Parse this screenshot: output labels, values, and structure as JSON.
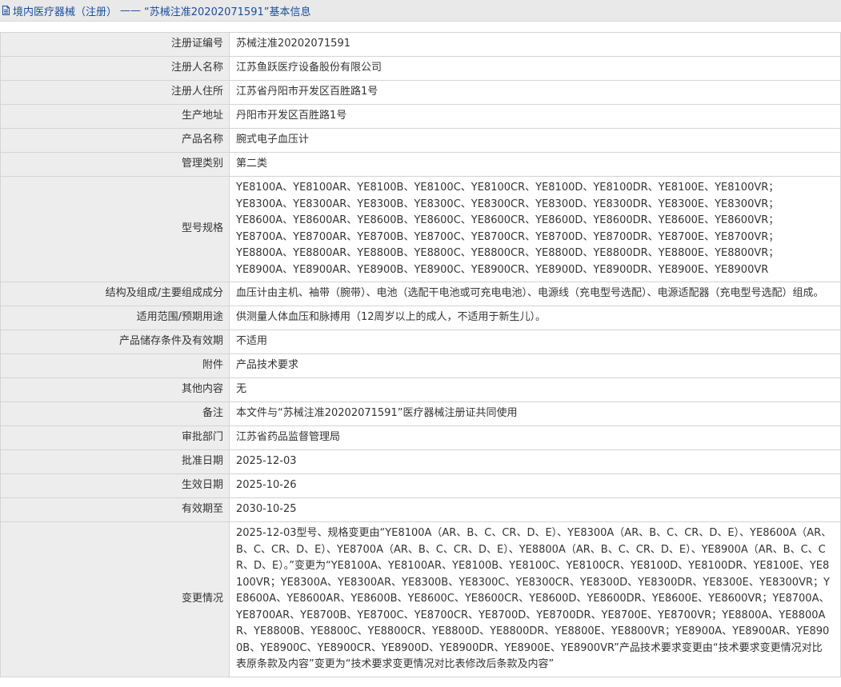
{
  "header": {
    "breadcrumb_label": "境内医疗器械（注册）",
    "separator": "——",
    "page_title": "“苏械注准20202071591”基本信息",
    "icon": "document-icon"
  },
  "rows": {
    "reg_no": {
      "label": "注册证编号",
      "value": "苏械注准20202071591"
    },
    "registrant": {
      "label": "注册人名称",
      "value": "江苏鱼跃医疗设备股份有限公司"
    },
    "registrant_address": {
      "label": "注册人住所",
      "value": "江苏省丹阳市开发区百胜路1号"
    },
    "production_address": {
      "label": "生产地址",
      "value": "丹阳市开发区百胜路1号"
    },
    "product_name": {
      "label": "产品名称",
      "value": "腕式电子血压计"
    },
    "category": {
      "label": "管理类别",
      "value": "第二类"
    },
    "models": {
      "label": "型号规格",
      "lines": [
        "YE8100A、YE8100AR、YE8100B、YE8100C、YE8100CR、YE8100D、YE8100DR、YE8100E、YE8100VR；",
        "YE8300A、YE8300AR、YE8300B、YE8300C、YE8300CR、YE8300D、YE8300DR、YE8300E、YE8300VR；",
        "YE8600A、YE8600AR、YE8600B、YE8600C、YE8600CR、YE8600D、YE8600DR、YE8600E、YE8600VR；",
        "YE8700A、YE8700AR、YE8700B、YE8700C、YE8700CR、YE8700D、YE8700DR、YE8700E、YE8700VR；",
        "YE8800A、YE8800AR、YE8800B、YE8800C、YE8800CR、YE8800D、YE8800DR、YE8800E、YE8800VR；",
        "YE8900A、YE8900AR、YE8900B、YE8900C、YE8900CR、YE8900D、YE8900DR、YE8900E、YE8900VR"
      ]
    },
    "structure": {
      "label": "结构及组成/主要组成成分",
      "value": "血压计由主机、袖带（腕带）、电池（选配干电池或可充电电池）、电源线（充电型号选配）、电源适配器（充电型号选配）组成。"
    },
    "scope": {
      "label": "适用范围/预期用途",
      "value": "供测量人体血压和脉搏用（12周岁以上的成人，不适用于新生儿）。"
    },
    "storage": {
      "label": "产品储存条件及有效期",
      "value": "不适用"
    },
    "attachment": {
      "label": "附件",
      "value": "产品技术要求"
    },
    "other": {
      "label": "其他内容",
      "value": "无"
    },
    "remark": {
      "label": "备注",
      "value": "本文件与“苏械注准20202071591”医疗器械注册证共同使用"
    },
    "approval_dept": {
      "label": "审批部门",
      "value": "江苏省药品监督管理局"
    },
    "approval_date": {
      "label": "批准日期",
      "value": "2025-12-03"
    },
    "effective_date": {
      "label": "生效日期",
      "value": "2025-10-26"
    },
    "expiry_date": {
      "label": "有效期至",
      "value": "2030-10-25"
    },
    "changes": {
      "label": "变更情况",
      "value": "2025-12-03型号、规格变更由“YE8100A（AR、B、C、CR、D、E）、YE8300A（AR、B、C、CR、D、E）、YE8600A（AR、B、C、CR、D、E）、YE8700A（AR、B、C、CR、D、E）、YE8800A（AR、B、C、CR、D、E）、YE8900A（AR、B、C、CR、D、E）。”变更为“YE8100A、YE8100AR、YE8100B、YE8100C、YE8100CR、YE8100D、YE8100DR、YE8100E、YE8100VR；YE8300A、YE8300AR、YE8300B、YE8300C、YE8300CR、YE8300D、YE8300DR、YE8300E、YE8300VR；YE8600A、YE8600AR、YE8600B、YE8600C、YE8600CR、YE8600D、YE8600DR、YE8600E、YE8600VR；YE8700A、YE8700AR、YE8700B、YE8700C、YE8700CR、YE8700D、YE8700DR、YE8700E、YE8700VR；YE8800A、YE8800AR、YE8800B、YE8800C、YE8800CR、YE8800D、YE8800DR、YE8800E、YE8800VR；YE8900A、YE8900AR、YE8900B、YE8900C、YE8900CR、YE8900D、YE8900DR、YE8900E、YE8900VR”产品技术要求变更由“技术要求变更情况对比表原条款及内容”变更为“技术要求变更情况对比表修改后条款及内容”"
    }
  },
  "colors": {
    "header_bg": "#e9e9e9",
    "header_text": "#1a4d9c",
    "label_bg": "#ededed",
    "border": "#d4d4d4",
    "text": "#333333"
  }
}
